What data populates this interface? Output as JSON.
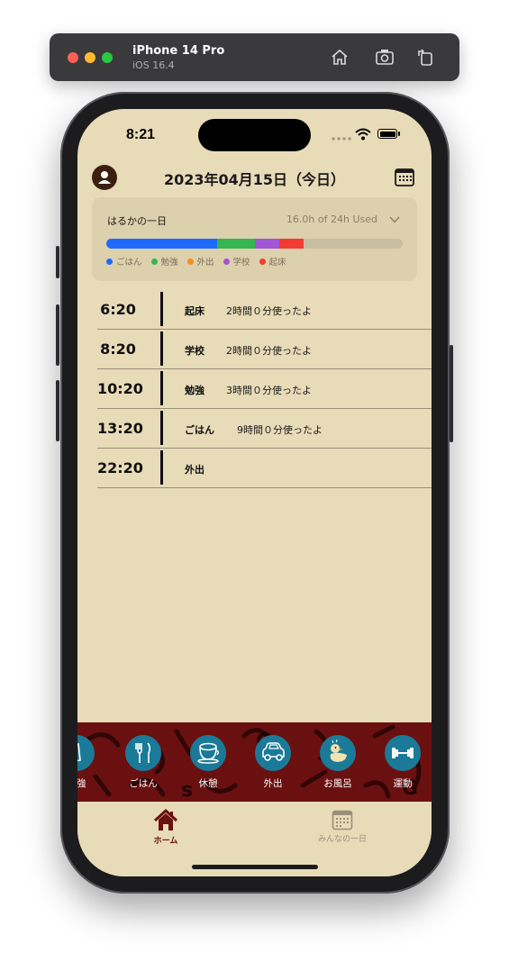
{
  "simulator": {
    "device": "iPhone 14 Pro",
    "os": "iOS 16.4"
  },
  "status": {
    "time": "8:21"
  },
  "header": {
    "date_title": "2023年04月15日（今日）"
  },
  "summary": {
    "name": "はるかの一日",
    "used": "16.0h of 24h Used",
    "bar_segments": [
      {
        "label": "ごはん",
        "hours": 9,
        "color": "#1f6bff"
      },
      {
        "label": "勉強",
        "hours": 3,
        "color": "#35b653"
      },
      {
        "label": "学校",
        "hours": 2,
        "color": "#a255d6"
      },
      {
        "label": "起床",
        "hours": 2,
        "color": "#f23b35"
      }
    ],
    "total_hours": 24,
    "legend": [
      {
        "label": "ごはん",
        "color": "#1f6bff"
      },
      {
        "label": "勉強",
        "color": "#35b653"
      },
      {
        "label": "外出",
        "color": "#ff8a1c"
      },
      {
        "label": "学校",
        "color": "#a255d6"
      },
      {
        "label": "起床",
        "color": "#f23b35"
      }
    ]
  },
  "timeline": [
    {
      "time": "6:20",
      "activity": "起床",
      "duration": "2時間０分使ったよ"
    },
    {
      "time": "8:20",
      "activity": "学校",
      "duration": "2時間０分使ったよ"
    },
    {
      "time": "10:20",
      "activity": "勉強",
      "duration": "3時間０分使ったよ"
    },
    {
      "time": "13:20",
      "activity": "ごはん",
      "duration": "9時間０分使ったよ"
    },
    {
      "time": "22:20",
      "activity": "外出",
      "duration": ""
    }
  ],
  "activities": [
    {
      "label": "勉強",
      "icon": "book-icon"
    },
    {
      "label": "ごはん",
      "icon": "fork-knife-icon"
    },
    {
      "label": "休憩",
      "icon": "cup-icon"
    },
    {
      "label": "外出",
      "icon": "car-icon"
    },
    {
      "label": "お風呂",
      "icon": "duck-icon"
    },
    {
      "label": "運動",
      "icon": "dumbbell-icon"
    }
  ],
  "tabs": [
    {
      "label": "ホーム",
      "icon": "house-icon",
      "active": true
    },
    {
      "label": "みんなの一日",
      "icon": "calendar-icon",
      "active": false
    }
  ],
  "colors": {
    "background": "#e8dbb8",
    "accent": "#6a1010",
    "activity_button": "#1a7a98"
  }
}
